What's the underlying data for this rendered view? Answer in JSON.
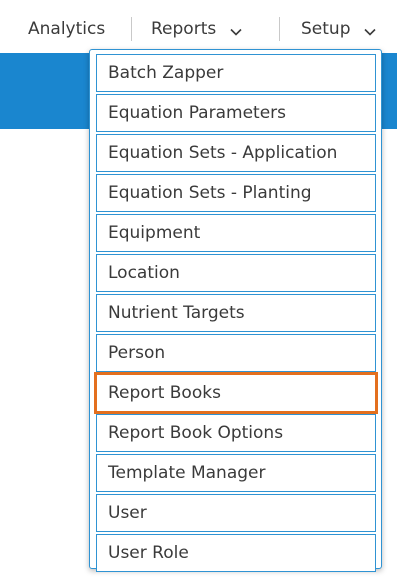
{
  "nav": {
    "analytics": "Analytics",
    "reports": "Reports",
    "setup": "Setup"
  },
  "setup_menu": {
    "items": [
      {
        "label": "Batch Zapper"
      },
      {
        "label": "Equation Parameters"
      },
      {
        "label": "Equation Sets - Application"
      },
      {
        "label": "Equation Sets - Planting"
      },
      {
        "label": "Equipment"
      },
      {
        "label": "Location"
      },
      {
        "label": "Nutrient Targets"
      },
      {
        "label": "Person"
      },
      {
        "label": "Report Books",
        "highlighted": true
      },
      {
        "label": "Report Book Options"
      },
      {
        "label": "Template Manager"
      },
      {
        "label": "User"
      },
      {
        "label": "User Role"
      }
    ]
  },
  "colors": {
    "header_band": "#1a86cf",
    "menu_border": "#2f93d3",
    "highlight": "#e36f1e"
  }
}
